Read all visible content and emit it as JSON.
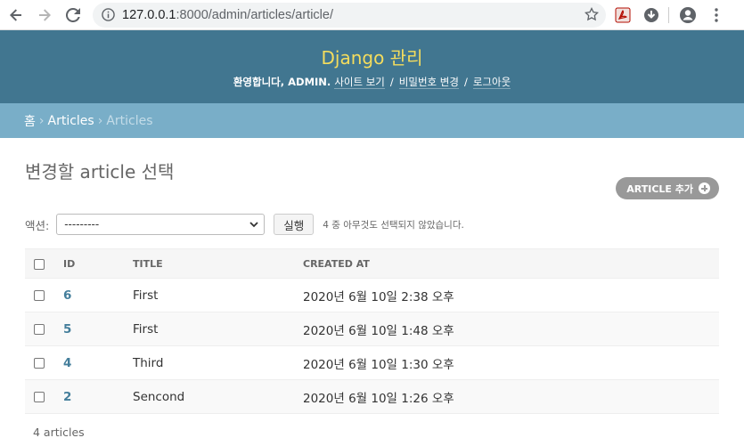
{
  "browser": {
    "url_host": "127.0.0.1",
    "url_path": ":8000/admin/articles/article/"
  },
  "header": {
    "brand": "Django 관리",
    "welcome": "환영합니다,",
    "username": "admin",
    "period": ".",
    "view_site": "사이트 보기",
    "change_password": "비밀번호 변경",
    "logout": "로그아웃",
    "slash": "/"
  },
  "breadcrumbs": {
    "home": "홈",
    "app": "Articles",
    "current": "Articles",
    "arrow": "›"
  },
  "page": {
    "title": "변경할 article 선택",
    "add_button": "ARTICLE 추가"
  },
  "actions": {
    "label": "액션:",
    "selected_option": "---------",
    "run_button": "실행",
    "selection_count": "4 중 아무것도 선택되지 않았습니다."
  },
  "table": {
    "headers": {
      "id": "ID",
      "title": "Title",
      "created_at": "Created at"
    },
    "rows": [
      {
        "id": "6",
        "title": "First",
        "created_at": "2020년 6월 10일 2:38 오후"
      },
      {
        "id": "5",
        "title": "First",
        "created_at": "2020년 6월 10일 1:48 오후"
      },
      {
        "id": "4",
        "title": "Third",
        "created_at": "2020년 6월 10일 1:30 오후"
      },
      {
        "id": "2",
        "title": "Sencond",
        "created_at": "2020년 6월 10일 1:26 오후"
      }
    ]
  },
  "paginator": "4 articles",
  "colors": {
    "header_bg": "#417690",
    "brand": "#f5dd5d",
    "breadcrumbs_bg": "#79aec8",
    "link": "#447e9b",
    "add_button_bg": "#999999"
  }
}
